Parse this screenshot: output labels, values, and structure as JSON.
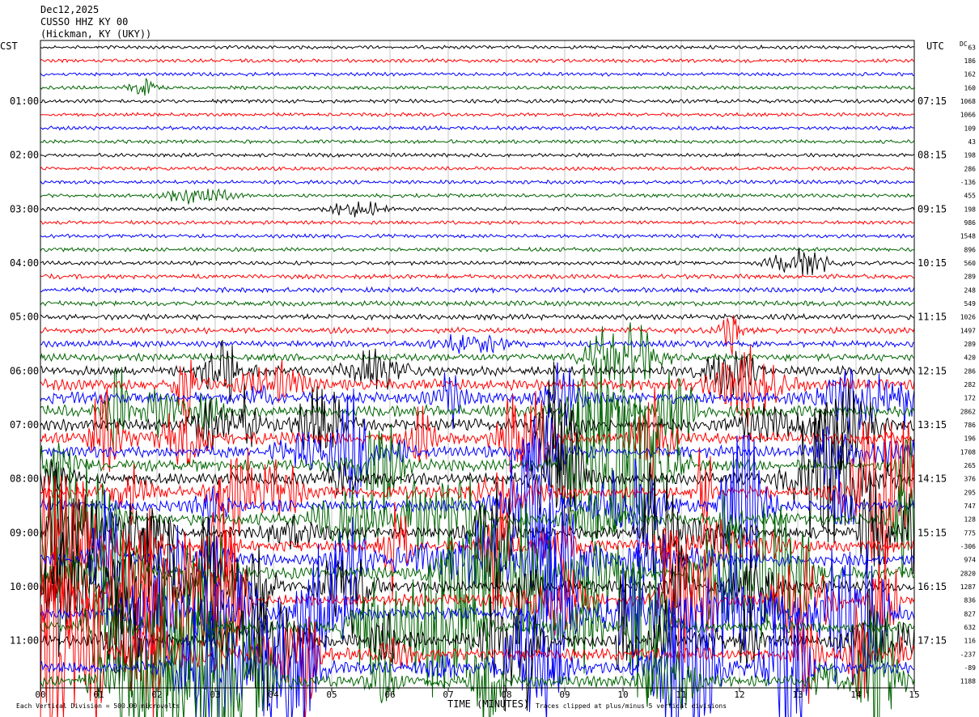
{
  "header": {
    "date": "Dec12,2025",
    "station": "CUSSO HHZ KY 00",
    "location": "(Hickman, KY (UKY))"
  },
  "left_axis_label": "CST",
  "right_axis_label": "UTC",
  "dc_label": "DC",
  "footer": {
    "scale_note": "Each Vertical Division = 500.00 microvolts",
    "xlabel": "TIME (MINUTES)",
    "clip_note": "Traces clipped at plus/minus 5 vertical divisions"
  },
  "colors": {
    "trace_cycle": [
      "#000000",
      "#ff0000",
      "#0000ff",
      "#006400"
    ],
    "grid": "#a0a0a0",
    "background": "#ffffff"
  },
  "chart_data": {
    "type": "helicorder",
    "lines": 48,
    "minutes_per_line": 15,
    "xlim": [
      0,
      15
    ],
    "xticks": [
      "00",
      "01",
      "02",
      "03",
      "04",
      "05",
      "06",
      "07",
      "08",
      "09",
      "10",
      "11",
      "12",
      "13",
      "14",
      "15"
    ],
    "left_labels": [
      "01:00",
      "02:00",
      "03:00",
      "04:00",
      "05:00",
      "06:00",
      "07:00",
      "08:00",
      "09:00",
      "10:00",
      "11:00"
    ],
    "left_label_lines": [
      4,
      8,
      12,
      16,
      20,
      24,
      28,
      32,
      36,
      40,
      44
    ],
    "right_labels": [
      "07:15",
      "08:15",
      "09:15",
      "10:15",
      "11:15",
      "12:15",
      "13:15",
      "14:15",
      "15:15",
      "16:15",
      "17:15"
    ],
    "right_label_lines": [
      4,
      8,
      12,
      16,
      20,
      24,
      28,
      32,
      36,
      40,
      44
    ],
    "dc_offsets": [
      "63",
      "186",
      "162",
      "160",
      "1068",
      "1066",
      "109",
      "43",
      "198",
      "286",
      "-136",
      "455",
      "198",
      "986",
      "1548",
      "896",
      "560",
      "289",
      "248",
      "549",
      "1026",
      "1497",
      "289",
      "420",
      "286",
      "282",
      "172",
      "2862",
      "786",
      "196",
      "1708",
      "265",
      "376",
      "295",
      "747",
      "128",
      "775",
      "-306",
      "974",
      "2820",
      "1287",
      "836",
      "827",
      "632",
      "116",
      "-237",
      "-89",
      "1188"
    ],
    "activity_profile": [
      0.25,
      0.25,
      0.25,
      0.25,
      0.3,
      0.3,
      0.3,
      0.3,
      0.3,
      0.3,
      0.3,
      0.3,
      0.3,
      0.3,
      0.3,
      0.35,
      0.35,
      0.5,
      0.6,
      0.6,
      0.7,
      0.8,
      0.9,
      1.1,
      1.6,
      2.0,
      2.2,
      2.4,
      2.6,
      2.8,
      3.0,
      3.2,
      3.4,
      3.6,
      3.8,
      4.0,
      4.2,
      4.4,
      4.6,
      4.8,
      5.0,
      5.0,
      5.0,
      5.0,
      5.0,
      5.0,
      5.0,
      5.0
    ],
    "vertical_divisions_clip": 5,
    "microvolts_per_division": 500.0
  }
}
